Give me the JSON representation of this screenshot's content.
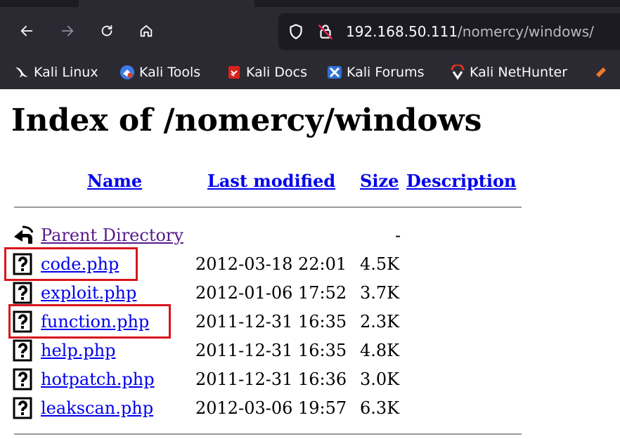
{
  "browser": {
    "url_host": "192.168.50.111",
    "url_path": "/nomercy/windows/",
    "bookmarks": [
      {
        "label": "Kali Linux",
        "icon": "kali-dragon-icon"
      },
      {
        "label": "Kali Tools",
        "icon": "kali-tools-icon"
      },
      {
        "label": "Kali Docs",
        "icon": "kali-docs-icon"
      },
      {
        "label": "Kali Forums",
        "icon": "kali-forums-icon"
      },
      {
        "label": "Kali NetHunter",
        "icon": "kali-nethunter-icon"
      }
    ],
    "colors": {
      "chrome_bg": "#2b2a33",
      "urlbar_bg": "#1c1b22",
      "text": "#fbfbfe"
    }
  },
  "page": {
    "title": "Index of /nomercy/windows",
    "columns": {
      "name": "Name",
      "last_modified": "Last modified",
      "size": "Size",
      "description": "Description"
    },
    "parent": {
      "label": "Parent Directory",
      "size": "-"
    },
    "files": [
      {
        "name": "code.php",
        "modified": "2012-03-18 22:01",
        "size": "4.5K",
        "highlighted": true
      },
      {
        "name": "exploit.php",
        "modified": "2012-01-06 17:52",
        "size": "3.7K",
        "highlighted": false
      },
      {
        "name": "function.php",
        "modified": "2011-12-31 16:35",
        "size": "2.3K",
        "highlighted": true
      },
      {
        "name": "help.php",
        "modified": "2011-12-31 16:35",
        "size": "4.8K",
        "highlighted": false
      },
      {
        "name": "hotpatch.php",
        "modified": "2011-12-31 16:36",
        "size": "3.0K",
        "highlighted": false
      },
      {
        "name": "leakscan.php",
        "modified": "2012-03-06 19:57",
        "size": "6.3K",
        "highlighted": false
      }
    ],
    "colors": {
      "link": "#0000ee",
      "visited": "#551a8b",
      "highlight_box": "#d9151c"
    }
  }
}
